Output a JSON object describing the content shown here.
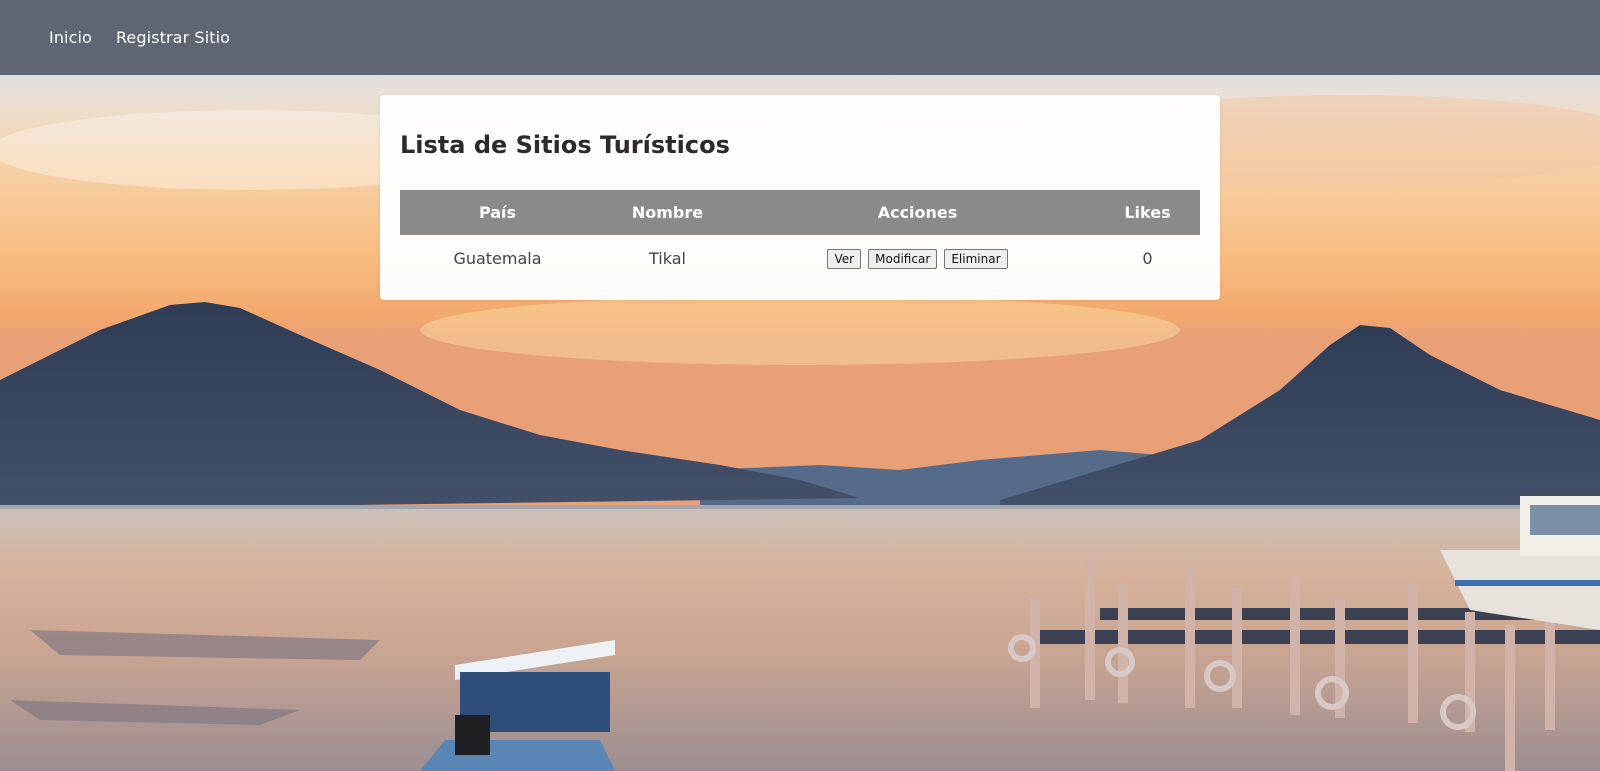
{
  "nav": {
    "items": [
      {
        "label": "Inicio"
      },
      {
        "label": "Registrar Sitio"
      }
    ]
  },
  "main": {
    "title": "Lista de Sitios Turísticos",
    "table": {
      "headers": [
        "País",
        "Nombre",
        "Acciones",
        "Likes"
      ],
      "rows": [
        {
          "pais": "Guatemala",
          "nombre": "Tikal",
          "actions": [
            "Ver",
            "Modificar",
            "Eliminar"
          ],
          "likes": "0"
        }
      ]
    }
  },
  "colors": {
    "navbar": "#565e6c",
    "table_header": "#8a8a8a",
    "card_bg": "#ffffff",
    "title_text": "#2b2b2b"
  }
}
